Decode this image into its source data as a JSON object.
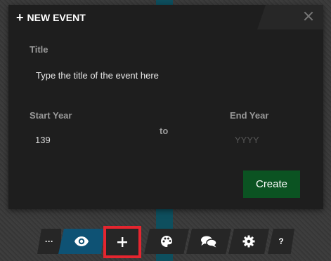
{
  "dialog": {
    "title": "NEW EVENT",
    "title_field": {
      "label": "Title",
      "placeholder": "Type the title of the event here",
      "value": ""
    },
    "start_year": {
      "label": "Start Year",
      "value": "139"
    },
    "separator": "to",
    "end_year": {
      "label": "End Year",
      "placeholder": "YYYY",
      "value": ""
    },
    "create_label": "Create"
  },
  "toolbar": {
    "more_label": "···",
    "help_label": "?",
    "buttons": [
      {
        "icon": "ellipsis-icon"
      },
      {
        "icon": "eye-icon",
        "active": true,
        "color": "#0e5274"
      },
      {
        "icon": "plus-icon",
        "highlight": "#e5252f"
      },
      {
        "icon": "palette-icon"
      },
      {
        "icon": "chat-icon"
      },
      {
        "icon": "gear-icon"
      },
      {
        "icon": "help-icon"
      }
    ]
  },
  "colors": {
    "timeline": "#0e4f5e",
    "create_button": "#0b5322",
    "dialog_bg": "#1e1e1e"
  }
}
